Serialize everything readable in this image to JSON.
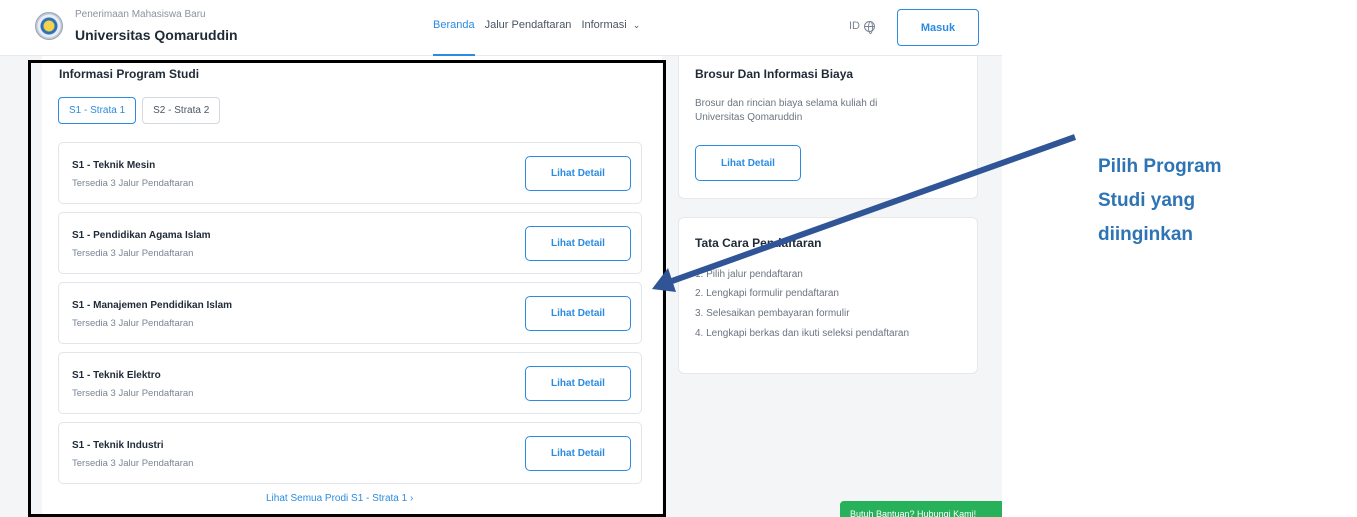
{
  "header": {
    "brand_sub": "Penerimaan Mahasiswa Baru",
    "brand_main": "Universitas Qomaruddin",
    "nav": [
      "Beranda",
      "Jalur Pendaftaran",
      "Informasi"
    ],
    "lang": "ID",
    "login_label": "Masuk"
  },
  "program": {
    "title": "Informasi Program Studi",
    "tabs": [
      "S1 - Strata 1",
      "S2 - Strata 2"
    ],
    "items": [
      {
        "name": "S1 - Teknik Mesin",
        "sub": "Tersedia 3 Jalur Pendaftaran",
        "btn": "Lihat Detail"
      },
      {
        "name": "S1 - Pendidikan Agama Islam",
        "sub": "Tersedia 3 Jalur Pendaftaran",
        "btn": "Lihat Detail"
      },
      {
        "name": "S1 - Manajemen Pendidikan Islam",
        "sub": "Tersedia 3 Jalur Pendaftaran",
        "btn": "Lihat Detail"
      },
      {
        "name": "S1 - Teknik Elektro",
        "sub": "Tersedia 3 Jalur Pendaftaran",
        "btn": "Lihat Detail"
      },
      {
        "name": "S1 - Teknik Industri",
        "sub": "Tersedia 3 Jalur Pendaftaran",
        "btn": "Lihat Detail"
      }
    ],
    "see_all": "Lihat Semua Prodi S1 - Strata 1 ›"
  },
  "brosur": {
    "title": "Brosur Dan Informasi Biaya",
    "text_1": "Brosur dan rincian biaya selama kuliah di",
    "text_2": "Universitas Qomaruddin",
    "btn": "Lihat Detail"
  },
  "tatacara": {
    "title": "Tata Cara Pendaftaran",
    "steps": [
      "1. Pilih jalur pendaftaran",
      "2. Lengkapi formulir pendaftaran",
      "3. Selesaikan pembayaran formulir",
      "4. Lengkapi berkas dan ikuti seleksi pendaftaran"
    ]
  },
  "help": "Butuh Bantuan? Hubungi Kami!",
  "annotation": {
    "line_1": "Pilih Program",
    "line_2": "Studi yang",
    "line_3": "diinginkan",
    "color": "#2e74b5"
  }
}
